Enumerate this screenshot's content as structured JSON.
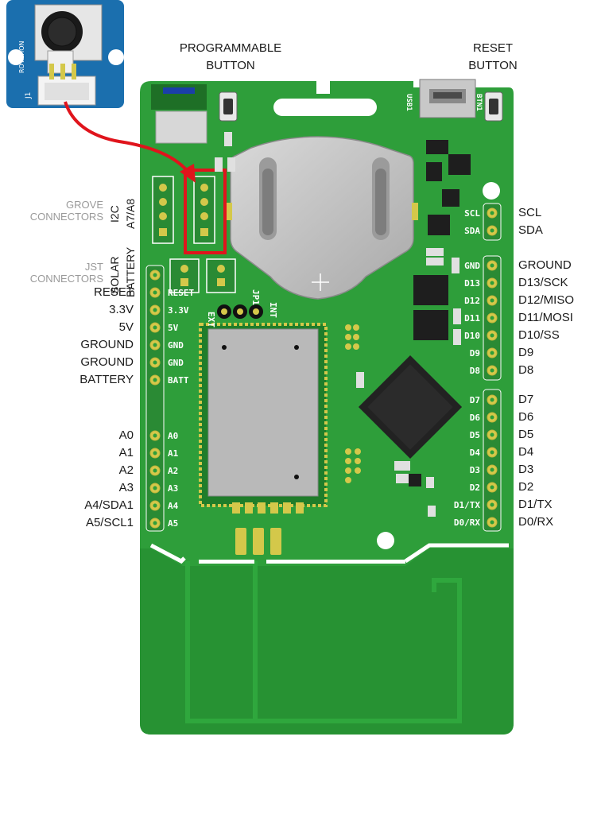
{
  "captions": {
    "programmable_button": [
      "PROGRAMMABLE",
      "BUTTON"
    ],
    "reset_button": [
      "RESET",
      "BUTTON"
    ]
  },
  "left_group_labels": {
    "grove_connectors": [
      "GROVE",
      "CONNECTORS"
    ],
    "jst_connectors": [
      "JST",
      "CONNECTORS"
    ],
    "i2c": "I2C",
    "a7_a8": "A7/A8",
    "solar": "SOLAR",
    "battery": "BATTERY"
  },
  "left_pins": [
    "RESET",
    "3.3V",
    "5V",
    "GROUND",
    "GROUND",
    "BATTERY"
  ],
  "left_pins_silk": [
    "RESET",
    "3.3V",
    "5V",
    "GND",
    "GND",
    "BATT"
  ],
  "analog_pins": [
    "A0",
    "A1",
    "A2",
    "A3",
    "A4/SDA1",
    "A5/SCL1"
  ],
  "analog_pins_silk": [
    "A0",
    "A1",
    "A2",
    "A3",
    "A4",
    "A5"
  ],
  "right_pins_top": [
    "SCL",
    "SDA"
  ],
  "right_pins_top_silk": [
    "SCL",
    "SDA"
  ],
  "right_pins_mid": [
    "GROUND",
    "D13/SCK",
    "D12/MISO",
    "D11/MOSI",
    "D10/SS",
    "D9",
    "D8"
  ],
  "right_pins_mid_silk": [
    "GND",
    "D13",
    "D12",
    "D11",
    "D10",
    "D9",
    "D8"
  ],
  "right_pins_low": [
    "D7",
    "D6",
    "D5",
    "D4",
    "D3",
    "D2",
    "D1/TX",
    "D0/RX"
  ],
  "right_pins_low_silk": [
    "D7",
    "D6",
    "D5",
    "D4",
    "D3",
    "D2",
    "D1/TX",
    "D0/RX"
  ],
  "board_silk": {
    "ext": "EXT",
    "int": "INT",
    "jp1": "JP1",
    "usb": "USB1",
    "btn": "BTN1"
  },
  "module": {
    "label": "ROTATION",
    "connector": "J1"
  },
  "colors": {
    "board": "#2e9e3a",
    "board_dark": "#1f7d2a",
    "highlight": "#e0141c",
    "pad": "#d4c84a"
  }
}
